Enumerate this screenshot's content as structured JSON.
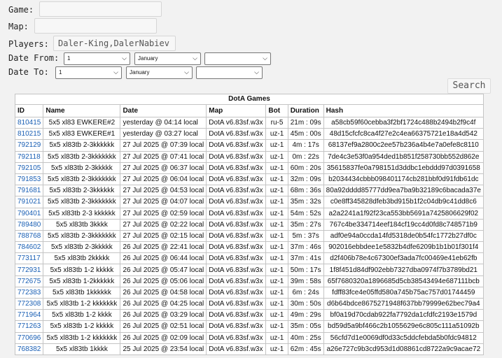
{
  "filters": {
    "game_label": "Game:",
    "game_value": "",
    "map_label": "Map:",
    "map_value": "",
    "players_label": "Players:",
    "players_value": "Daler-King,DalerNabiev",
    "date_from_label": "Date From:",
    "date_from_day": "1",
    "date_from_month": "January",
    "date_from_year": "",
    "date_to_label": "Date To:",
    "date_to_day": "1",
    "date_to_month": "January",
    "date_to_year": "",
    "search_label": "Search"
  },
  "table": {
    "caption": "DotA Games",
    "headers": [
      "ID",
      "Name",
      "Date",
      "Map",
      "Bot",
      "Duration",
      "Hash"
    ],
    "rows": [
      [
        "810415",
        "5x5 xl83 EWKERE#2",
        "yesterday @ 04:14 local",
        "DotA v6.83sf.w3x",
        "ru-5",
        "21m : 09s",
        "a58cb59f60cebba3f2bf1724c488b2494b2f9c4f"
      ],
      [
        "810215",
        "5x5 xl83 EWKERE#1",
        "yesterday @ 03:27 local",
        "DotA v6.83sf.w3x",
        "uz-1",
        "45m : 00s",
        "48d15cfcfc8ca4f27e2c4ea66375721e18a4d542"
      ],
      [
        "792129",
        "5x5 xl83tb 2-3kkkkkk",
        "27 Jul 2025 @ 07:39 local",
        "DotA v6.83sf.w3x",
        "uz-1",
        "4m : 17s",
        "68137ef9a2800c2ee57b236a4b4e7a0efe8c8110"
      ],
      [
        "792118",
        "5x5 xl83tb 2-3kkkkkkk",
        "27 Jul 2025 @ 07:41 local",
        "DotA v6.83sf.w3x",
        "uz-1",
        "0m : 22s",
        "7de4c3e53f0a954ded1b851f258730bb552d862e"
      ],
      [
        "792105",
        "5x5 xl83tb 2-3kkkkk",
        "27 Jul 2025 @ 06:37 local",
        "DotA v6.83sf.w3x",
        "uz-1",
        "60m : 20s",
        "35615837fe0a798151d3ddbc1ebddd97d0391658"
      ],
      [
        "791853",
        "5x5 xl83tb 2-3kkkkkkk",
        "27 Jul 2025 @ 06:04 local",
        "DotA v6.83sf.w3x",
        "uz-1",
        "32m : 09s",
        "b2034434cbbb098401174cb281bbf0d91fdb61dc"
      ],
      [
        "791681",
        "5x5 xl83tb 2-3kkkkkk",
        "27 Jul 2025 @ 04:53 local",
        "DotA v6.83sf.w3x",
        "uz-1",
        "68m : 36s",
        "80a92dddd85777dd9ea7ba9b32189c6bacada37e"
      ],
      [
        "791021",
        "5x5 xl83tb 2-3kkkkkkk",
        "27 Jul 2025 @ 04:07 local",
        "DotA v6.83sf.w3x",
        "uz-1",
        "35m : 32s",
        "c0e8ff345828dfeb3bd915b1f2c04db9c41dd8c6"
      ],
      [
        "790401",
        "5x5 xl83tb 2-3 kkkkkk",
        "27 Jul 2025 @ 02:59 local",
        "DotA v6.83sf.w3x",
        "uz-1",
        "54m : 52s",
        "a2a2241a1f92f23ca553bb5691a7425806629f02"
      ],
      [
        "789480",
        "5x5 xl83tb 3kkkk",
        "27 Jul 2025 @ 02:22 local",
        "DotA v6.83sf.w3x",
        "uz-1",
        "35m : 27s",
        "767c4be334714eef184cf19cc4d0fd8c748571b9"
      ],
      [
        "788768",
        "5x5 xl83tb 2-3kkkkkkk",
        "27 Jul 2025 @ 02:15 local",
        "DotA v6.83sf.w3x",
        "uz-1",
        "5m : 37s",
        "adf0e94a0ccda14fd5318de0b54fc1772b27df0c"
      ],
      [
        "784602",
        "5x5 xl83tb 2-3kkkkk",
        "26 Jul 2025 @ 22:41 local",
        "DotA v6.83sf.w3x",
        "uz-1",
        "37m : 46s",
        "902016ebbdee1e5832b4dfe6209b1b1b01f301f4"
      ],
      [
        "773117",
        "5x5 xl83tb 2kkkkk",
        "26 Jul 2025 @ 06:44 local",
        "DotA v6.83sf.w3x",
        "uz-1",
        "37m : 41s",
        "d2f406b78e4c67300ef3ada7fc00469e41eb62fb"
      ],
      [
        "772931",
        "5x5 xl83tb 1-2 kkkkk",
        "26 Jul 2025 @ 05:47 local",
        "DotA v6.83sf.w3x",
        "uz-1",
        "50m : 17s",
        "1f8f451d84df902ebb7327dba0974f7b3789bd21"
      ],
      [
        "772675",
        "5x5 xl83tb 1-2kkkkkk",
        "26 Jul 2025 @ 05:06 local",
        "DotA v6.83sf.w3x",
        "uz-1",
        "39m : 58s",
        "65f7680320a1896685d5cb38543494e687111bcb"
      ],
      [
        "772383",
        "5x5 xl83tb 1kkkkkk",
        "26 Jul 2025 @ 04:58 local",
        "DotA v6.83sf.w3x",
        "uz-1",
        "6m : 24s",
        "fdff83fce4e05ffd580a745b75ac757d01744459"
      ],
      [
        "772308",
        "5x5 xl83tb 1-2 kkkkkkk",
        "26 Jul 2025 @ 04:25 local",
        "DotA v6.83sf.w3x",
        "uz-1",
        "30m : 50s",
        "d6b64bdce8675271948f637bb79999e62bec79a4"
      ],
      [
        "771964",
        "5x5 xl83tb 1-2 kkkk",
        "26 Jul 2025 @ 03:29 local",
        "DotA v6.83sf.w3x",
        "uz-1",
        "49m : 29s",
        "bf0a19d70cdab922fa7792da1cfdfc2193e1579d"
      ],
      [
        "771263",
        "5x5 xl83tb 1-2 kkkkk",
        "26 Jul 2025 @ 02:51 local",
        "DotA v6.83sf.w3x",
        "uz-1",
        "35m : 05s",
        "bd59d5a9bf466c2b1055629e6c805c111a51092b"
      ],
      [
        "770696",
        "5x5 xl83tb 1-2 kkkkkkk",
        "26 Jul 2025 @ 02:09 local",
        "DotA v6.83sf.w3x",
        "uz-1",
        "40m : 25s",
        "56cfd7d1e0069df0d33c5ddcfebda5b0fdc94812"
      ],
      [
        "768382",
        "5x5 xl83tb 1kkkk",
        "25 Jul 2025 @ 23:54 local",
        "DotA v6.83sf.w3x",
        "uz-1",
        "62m : 45s",
        "a26e727c9b3cd953d1d08861cd8722a9c9acae72"
      ]
    ]
  }
}
